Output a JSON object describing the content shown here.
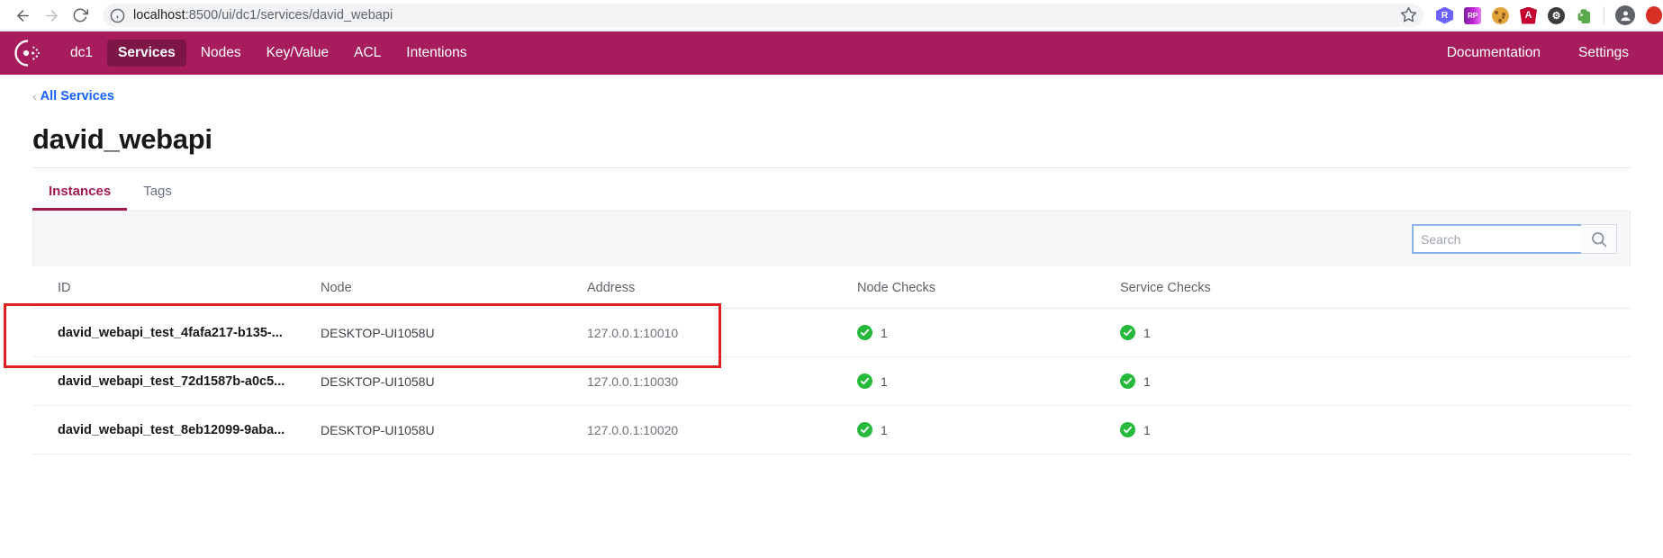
{
  "browser": {
    "back_icon": "arrow-left-icon",
    "forward_icon": "arrow-right-icon",
    "reload_icon": "reload-icon",
    "site_info_icon": "info-circle-icon",
    "url_host": "localhost",
    "url_path": ":8500/ui/dc1/services/david_webapi",
    "url_full": "localhost:8500/ui/dc1/services/david_webapi",
    "bookmark_icon": "star-icon",
    "extensions": [
      {
        "name": "hexagon-r-icon",
        "label": "R"
      },
      {
        "name": "rp-icon",
        "label": "RP"
      },
      {
        "name": "cookie-icon",
        "label": ""
      },
      {
        "name": "angular-icon",
        "label": "A"
      },
      {
        "name": "gear-extension-icon",
        "label": "⚙"
      },
      {
        "name": "evernote-icon",
        "label": "◆"
      }
    ],
    "profile_icon": "user-avatar-icon",
    "profile_glyph": "●"
  },
  "nav": {
    "logo_name": "consul-logo",
    "datacenter": "dc1",
    "items": [
      {
        "label": "Services",
        "active": true
      },
      {
        "label": "Nodes",
        "active": false
      },
      {
        "label": "Key/Value",
        "active": false
      },
      {
        "label": "ACL",
        "active": false
      },
      {
        "label": "Intentions",
        "active": false
      }
    ],
    "right_items": [
      {
        "label": "Documentation"
      },
      {
        "label": "Settings"
      }
    ],
    "brand_color": "#a61c5d",
    "active_color": "#7d1546"
  },
  "breadcrumb": {
    "chevron": "‹",
    "label": "All Services",
    "link_color": "#1563ff"
  },
  "page": {
    "title": "david_webapi"
  },
  "tabs": [
    {
      "label": "Instances",
      "active": true
    },
    {
      "label": "Tags",
      "active": false
    }
  ],
  "search": {
    "value": "",
    "placeholder": "Search",
    "button_icon": "search-icon",
    "focus_color": "#8ab4e8"
  },
  "table": {
    "columns": [
      "ID",
      "Node",
      "Address",
      "Node Checks",
      "Service Checks"
    ],
    "rows": [
      {
        "id": "david_webapi_test_4fafa217-b135-...",
        "node": "DESKTOP-UI1058U",
        "address": "127.0.0.1:10010",
        "node_checks": "1",
        "service_checks": "1",
        "highlighted": false
      },
      {
        "id": "david_webapi_test_72d1587b-a0c5...",
        "node": "DESKTOP-UI1058U",
        "address": "127.0.0.1:10030",
        "node_checks": "1",
        "service_checks": "1",
        "highlighted": true
      },
      {
        "id": "david_webapi_test_8eb12099-9aba...",
        "node": "DESKTOP-UI1058U",
        "address": "127.0.0.1:10020",
        "node_checks": "1",
        "service_checks": "1",
        "highlighted": false
      }
    ],
    "check_ok_color": "#25ba3c"
  },
  "annotation": {
    "name": "red-highlight-rectangle",
    "color": "#e02121",
    "target_row_index": 1
  }
}
